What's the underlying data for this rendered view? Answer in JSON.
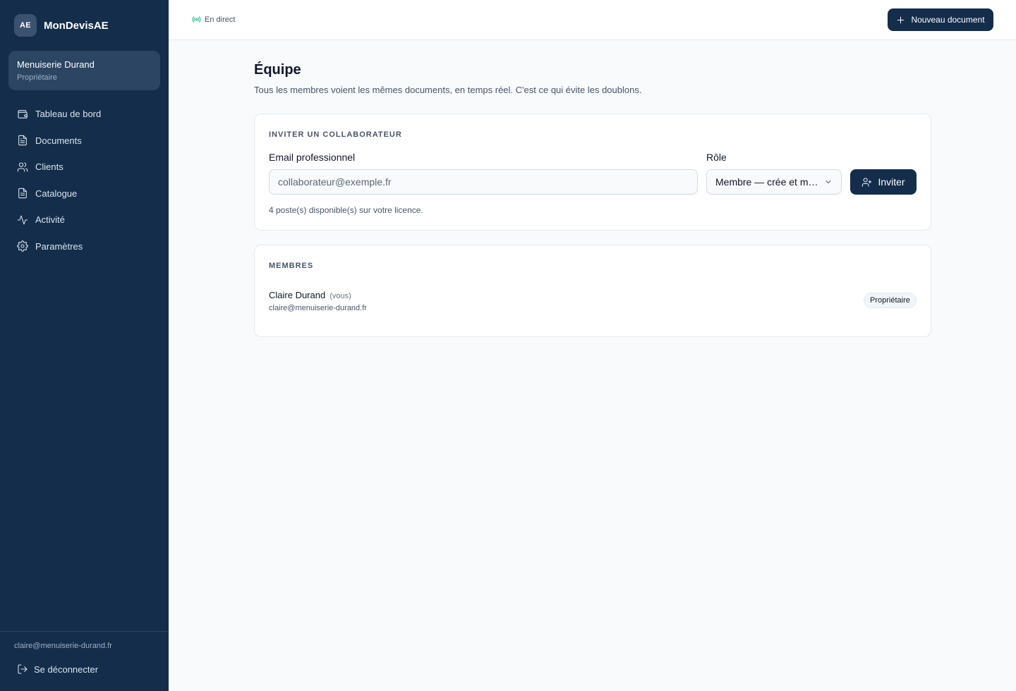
{
  "brand": {
    "badge": "AE",
    "name": "MonDevisAE"
  },
  "organization": {
    "name": "Menuiserie Durand",
    "role": "Propriétaire"
  },
  "nav": {
    "items": [
      {
        "label": "Tableau de bord",
        "icon": "wallet-icon"
      },
      {
        "label": "Documents",
        "icon": "file-text-icon"
      },
      {
        "label": "Clients",
        "icon": "users-icon"
      },
      {
        "label": "Catalogue",
        "icon": "file-list-icon"
      },
      {
        "label": "Activité",
        "icon": "activity-icon"
      },
      {
        "label": "Paramètres",
        "icon": "gear-icon"
      }
    ]
  },
  "footer": {
    "email": "claire@menuiserie-durand.fr",
    "logout_label": "Se déconnecter"
  },
  "topbar": {
    "live_label": "En direct",
    "new_document_label": "Nouveau document"
  },
  "page": {
    "title": "Équipe",
    "subtitle": "Tous les membres voient les mêmes documents, en temps réel. C'est ce qui évite les doublons."
  },
  "invite": {
    "section_title": "INVITER UN COLLABORATEUR",
    "email_label": "Email professionnel",
    "email_placeholder": "collaborateur@exemple.fr",
    "email_value": "",
    "role_label": "Rôle",
    "role_selected": "Membre — crée et modifie",
    "invite_button": "Inviter",
    "seats_info": "4 poste(s) disponible(s) sur votre licence."
  },
  "members": {
    "section_title": "MEMBRES",
    "list": [
      {
        "name": "Claire Durand",
        "you_tag": "(vous)",
        "email": "claire@menuiserie-durand.fr",
        "role": "Propriétaire"
      }
    ]
  },
  "colors": {
    "sidebar": "#132d4b",
    "primary": "#132d4b",
    "live": "#10b981",
    "background": "#f8fafc"
  }
}
